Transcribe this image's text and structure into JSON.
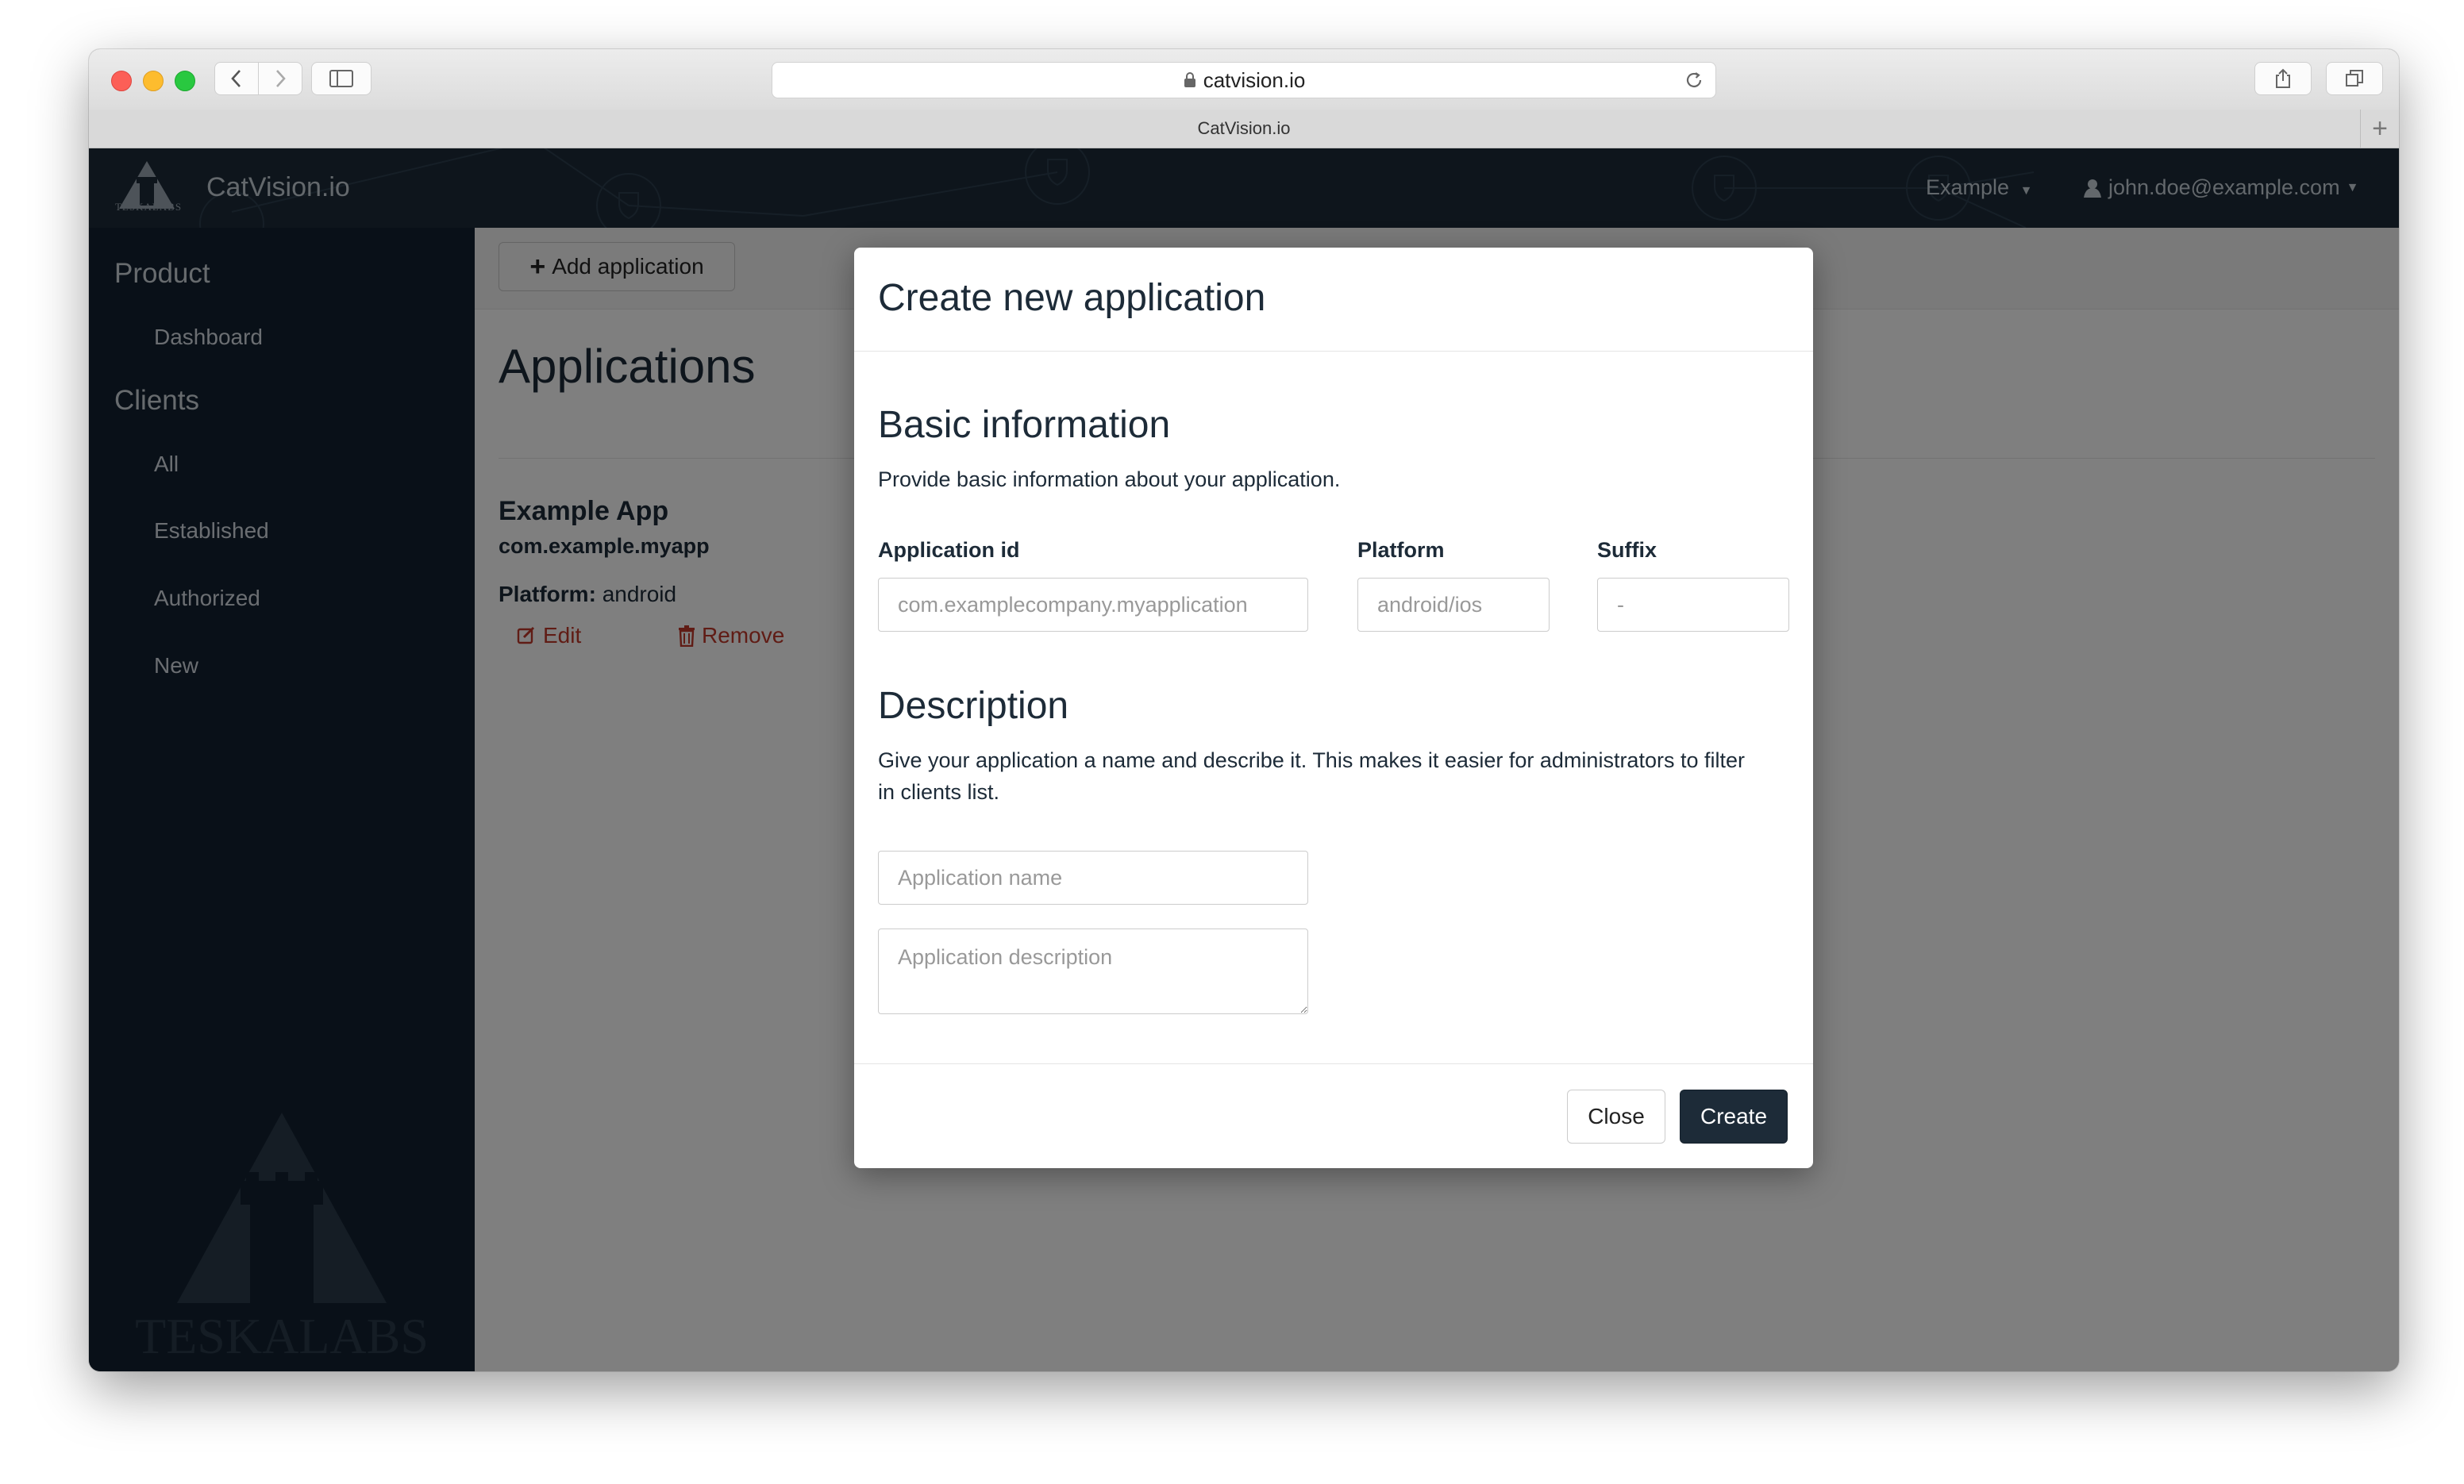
{
  "browser": {
    "url": "catvision.io",
    "tab_title": "CatVision.io"
  },
  "navbar": {
    "brand": "CatVision.io",
    "logo_text": "TESKALABS",
    "context_dropdown": "Example",
    "user": "john.doe@example.com"
  },
  "sidebar": {
    "product_heading": "Product",
    "product_items": [
      {
        "label": "Dashboard"
      }
    ],
    "clients_heading": "Clients",
    "clients_items": [
      {
        "label": "All"
      },
      {
        "label": "Established"
      },
      {
        "label": "Authorized"
      },
      {
        "label": "New"
      }
    ],
    "watermark_text": "TESKALABS"
  },
  "content": {
    "add_button": "Add application",
    "page_title": "Applications",
    "app": {
      "name": "Example App",
      "package": "com.example.myapp",
      "platform_label": "Platform:",
      "platform_value": "android",
      "edit_label": "Edit",
      "remove_label": "Remove"
    }
  },
  "modal": {
    "title": "Create new application",
    "basic": {
      "title": "Basic information",
      "help": "Provide basic information about your application.",
      "app_id_label": "Application id",
      "app_id_placeholder": "com.examplecompany.myapplication",
      "platform_label": "Platform",
      "platform_placeholder": "android/ios",
      "suffix_label": "Suffix",
      "suffix_placeholder": "-"
    },
    "description": {
      "title": "Description",
      "help": "Give your application a name and describe it. This makes it easier for administrators to filter in clients list.",
      "name_placeholder": "Application name",
      "desc_placeholder": "Application description"
    },
    "close_label": "Close",
    "create_label": "Create"
  },
  "colors": {
    "navbar": "#1d2b38",
    "sidebar": "#122130",
    "primary": "#1d2b38",
    "danger": "#c0392b"
  }
}
